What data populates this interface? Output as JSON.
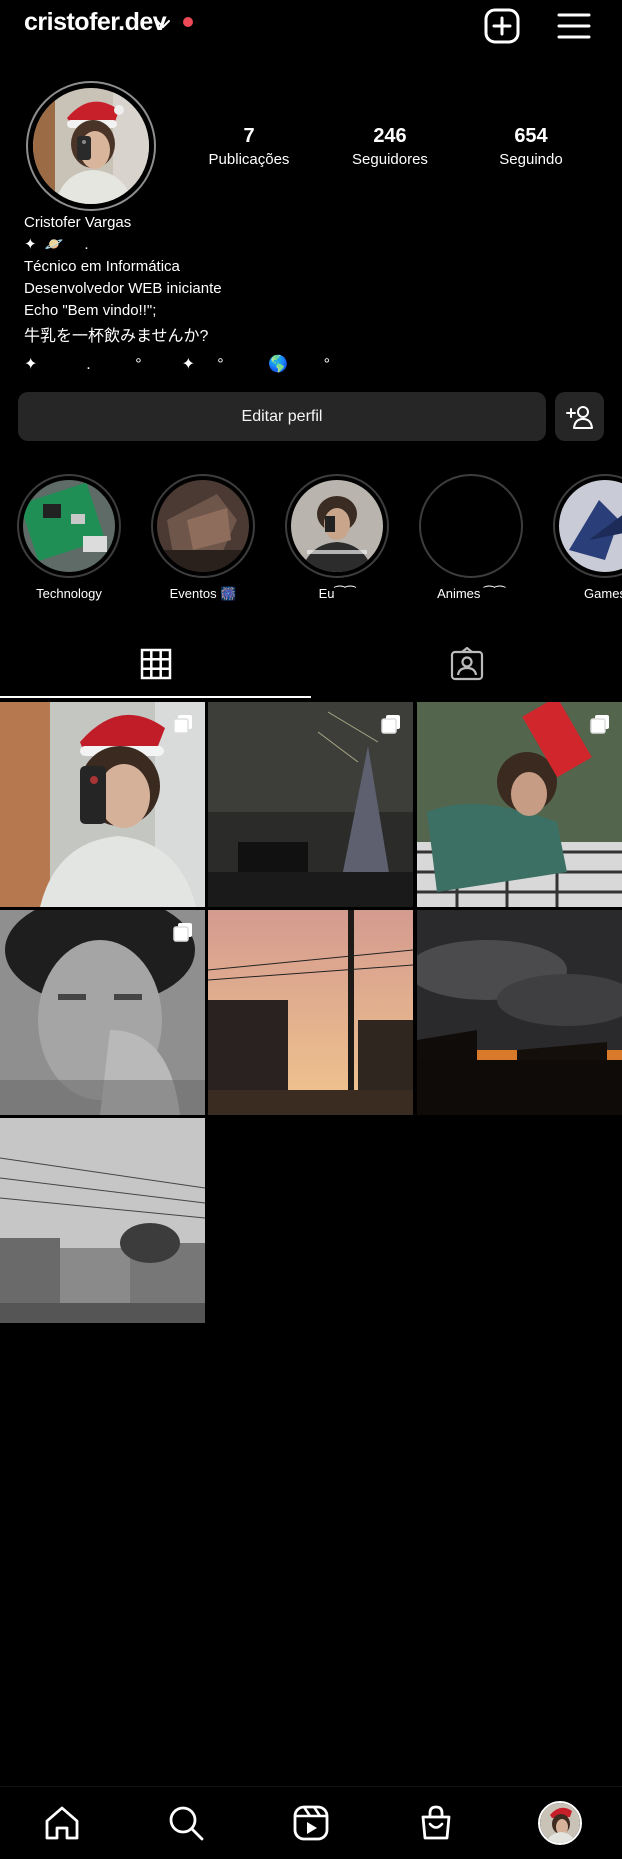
{
  "header": {
    "username": "cristofer.dev",
    "icons": [
      "chevron-down-icon",
      "new-post-icon",
      "menu-icon"
    ],
    "live_dot_color": "#ed4956"
  },
  "profile": {
    "stats": [
      {
        "value": "7",
        "label": "Publicações"
      },
      {
        "value": "246",
        "label": "Seguidores"
      },
      {
        "value": "654",
        "label": "Seguindo"
      }
    ],
    "name": "Cristofer Vargas",
    "bio_decor": "✦  🪐     .",
    "bio_lines": [
      "Técnico em Informática",
      "Desenvolvedor WEB iniciante",
      "Echo \"Bem vindo!!\";"
    ],
    "bio_jp": "牛乳を一杯飲みませんか?",
    "bio_stars": "✦           .          °         ✦     °          🌎        °"
  },
  "actions": {
    "edit_label": "Editar perfil",
    "add_friend_icon": "add-person-icon"
  },
  "highlights": [
    {
      "label": "Technology"
    },
    {
      "label": "Eventos 🎆"
    },
    {
      "label": "Eu⁀⁀"
    },
    {
      "label": "Animes ⁀⁀"
    },
    {
      "label": "Games"
    }
  ],
  "tabs": {
    "active": "grid",
    "icons": [
      "grid-icon",
      "tagged-icon"
    ]
  },
  "nav": {
    "icons": [
      "home-icon",
      "search-icon",
      "reels-icon",
      "shop-icon",
      "profile-avatar"
    ]
  },
  "colors": {
    "background": "#000000",
    "button_bg": "#262626",
    "text": "#ffffff"
  }
}
